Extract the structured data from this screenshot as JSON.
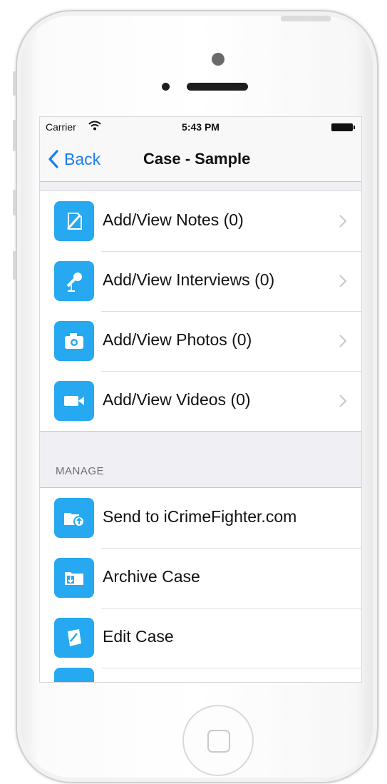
{
  "status_bar": {
    "carrier": "Carrier",
    "time": "5:43 PM"
  },
  "nav": {
    "back_label": "Back",
    "title": "Case - Sample"
  },
  "case_items": [
    {
      "label": "Add/View Notes (0)",
      "icon": "note-icon"
    },
    {
      "label": "Add/View Interviews (0)",
      "icon": "microphone-icon"
    },
    {
      "label": "Add/View Photos (0)",
      "icon": "camera-icon"
    },
    {
      "label": "Add/View Videos (0)",
      "icon": "video-camera-icon"
    }
  ],
  "manage": {
    "header": "MANAGE",
    "items": [
      {
        "label": "Send to iCrimeFighter.com",
        "icon": "folder-upload-icon"
      },
      {
        "label": "Archive Case",
        "icon": "archive-box-icon"
      },
      {
        "label": "Edit Case",
        "icon": "edit-folder-icon"
      }
    ]
  },
  "colors": {
    "accent": "#1a7cf5",
    "icon_background": "#26a9f1"
  }
}
